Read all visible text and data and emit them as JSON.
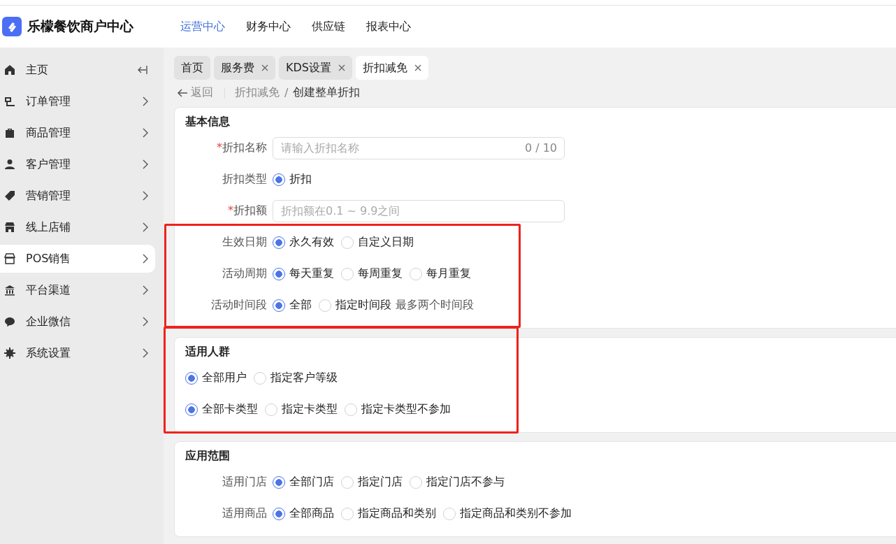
{
  "header": {
    "app_name": "乐檬餐饮商户中心",
    "nav": [
      {
        "label": "运营中心",
        "selected": true
      },
      {
        "label": "财务中心",
        "selected": false
      },
      {
        "label": "供应链",
        "selected": false
      },
      {
        "label": "报表中心",
        "selected": false
      }
    ]
  },
  "sidebar": {
    "items": [
      {
        "label": "主页",
        "kind": "collapse",
        "selected": false
      },
      {
        "label": "订单管理",
        "kind": "submenu",
        "selected": false
      },
      {
        "label": "商品管理",
        "kind": "submenu",
        "selected": false
      },
      {
        "label": "客户管理",
        "kind": "submenu",
        "selected": false
      },
      {
        "label": "营销管理",
        "kind": "submenu",
        "selected": false
      },
      {
        "label": "线上店铺",
        "kind": "submenu",
        "selected": false
      },
      {
        "label": "POS销售",
        "kind": "submenu",
        "selected": true
      },
      {
        "label": "平台渠道",
        "kind": "submenu",
        "selected": false
      },
      {
        "label": "企业微信",
        "kind": "submenu",
        "selected": false
      },
      {
        "label": "系统设置",
        "kind": "submenu",
        "selected": false
      }
    ]
  },
  "tabs": [
    {
      "label": "首页",
      "closable": false,
      "selected": false
    },
    {
      "label": "服务费",
      "closable": true,
      "selected": false
    },
    {
      "label": "KDS设置",
      "closable": true,
      "selected": false
    },
    {
      "label": "折扣减免",
      "closable": true,
      "selected": true
    }
  ],
  "back_link": "返回",
  "breadcrumb": [
    "折扣减免",
    "创建整单折扣"
  ],
  "breadcrumb_separator": "/",
  "sections": [
    {
      "title": "基本信息",
      "highlighted": false,
      "groups": [
        {
          "highlighted": false,
          "rows": [
            {
              "kind": "input",
              "label": "折扣名称",
              "required_mark": "*",
              "placeholder": "请输入折扣名称",
              "counter": "0 / 10"
            },
            {
              "kind": "radio",
              "label": "折扣类型",
              "options": [
                {
                  "label": "折扣",
                  "selected": true
                }
              ]
            },
            {
              "kind": "input",
              "label": "折扣额",
              "required_mark": "*",
              "placeholder": "折扣额在0.1 ~ 9.9之间"
            }
          ]
        },
        {
          "highlighted": true,
          "rows": [
            {
              "kind": "radio",
              "label": "生效日期",
              "options": [
                {
                  "label": "永久有效",
                  "selected": true
                },
                {
                  "label": "自定义日期",
                  "selected": false
                }
              ]
            },
            {
              "kind": "radio",
              "label": "活动周期",
              "options": [
                {
                  "label": "每天重复",
                  "selected": true
                },
                {
                  "label": "每周重复",
                  "selected": false
                },
                {
                  "label": "每月重复",
                  "selected": false
                }
              ]
            },
            {
              "kind": "radio",
              "label": "活动时间段",
              "options": [
                {
                  "label": "全部",
                  "selected": true
                },
                {
                  "label": "指定时间段",
                  "selected": false
                }
              ],
              "hint": "最多两个时间段"
            }
          ]
        }
      ]
    },
    {
      "title": "适用人群",
      "highlighted": true,
      "groups": [
        {
          "highlighted": false,
          "rows": [
            {
              "kind": "radio",
              "options": [
                {
                  "label": "全部用户",
                  "selected": true
                },
                {
                  "label": "指定客户等级",
                  "selected": false
                }
              ]
            },
            {
              "kind": "radio",
              "options": [
                {
                  "label": "全部卡类型",
                  "selected": true
                },
                {
                  "label": "指定卡类型",
                  "selected": false
                },
                {
                  "label": "指定卡类型不参加",
                  "selected": false
                }
              ]
            }
          ]
        }
      ]
    },
    {
      "title": "应用范围",
      "highlighted": false,
      "groups": [
        {
          "highlighted": false,
          "rows": [
            {
              "kind": "radio",
              "label": "适用门店",
              "options": [
                {
                  "label": "全部门店",
                  "selected": true
                },
                {
                  "label": "指定门店",
                  "selected": false
                },
                {
                  "label": "指定门店不参与",
                  "selected": false
                }
              ]
            },
            {
              "kind": "radio",
              "label": "适用商品",
              "options": [
                {
                  "label": "全部商品",
                  "selected": true
                },
                {
                  "label": "指定商品和类别",
                  "selected": false
                },
                {
                  "label": "指定商品和类别不参加",
                  "selected": false
                }
              ]
            }
          ]
        }
      ]
    }
  ]
}
